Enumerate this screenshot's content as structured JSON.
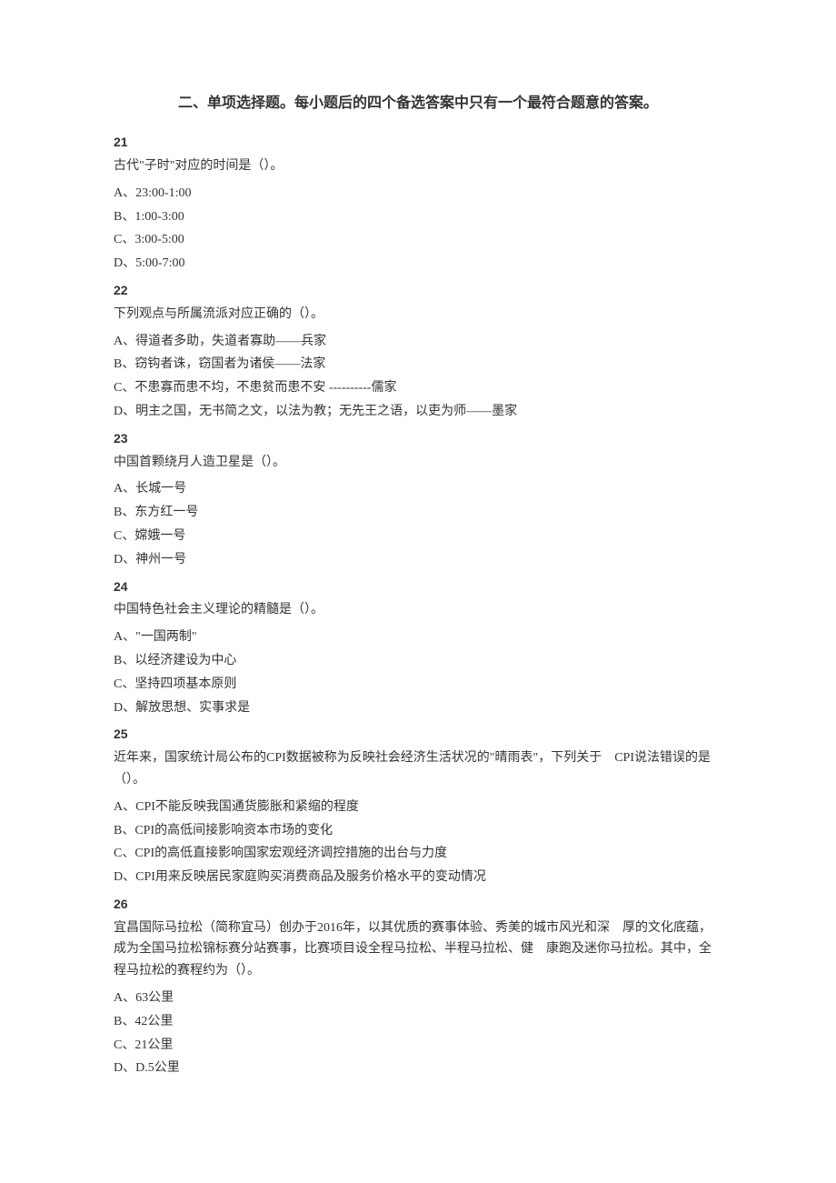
{
  "section_title": "二、单项选择题。每小题后的四个备选答案中只有一个最符合题意的答案。",
  "questions": [
    {
      "num": "21",
      "stem": "古代\"子时\"对应的时间是（）。",
      "opts": [
        "A、23:00-1:00",
        "B、1:00-3:00",
        "C、3:00-5:00",
        "D、5:00-7:00"
      ]
    },
    {
      "num": "22",
      "stem": "下列观点与所属流派对应正确的（）。",
      "opts": [
        "A、得道者多助，失道者寡助——兵家",
        "B、窃钩者诛，窃国者为诸侯——法家",
        "C、不患寡而患不均，不患贫而患不安 ----------儒家",
        "D、明主之国，无书简之文，以法为教；无先王之语，以吏为师——墨家"
      ]
    },
    {
      "num": "23",
      "stem": "中国首颗绕月人造卫星是（）。",
      "opts": [
        "A、长城一号",
        "B、东方红一号",
        "C、嫦娥一号",
        "D、神州一号"
      ]
    },
    {
      "num": "24",
      "stem": "中国特色社会主义理论的精髓是（）。",
      "opts": [
        "A、\"一国两制\"",
        "B、以经济建设为中心",
        "C、坚持四项基本原则",
        "D、解放思想、实事求是"
      ]
    },
    {
      "num": "25",
      "stem": "近年来，国家统计局公布的CPI数据被称为反映社会经济生活状况的\"晴雨表\"，下列关于　CPI说法错误的是（）。",
      "opts": [
        "A、CPI不能反映我国通货膨胀和紧缩的程度",
        "B、CPI的高低间接影响资本市场的变化",
        "C、CPI的高低直接影响国家宏观经济调控措施的出台与力度",
        "D、CPI用来反映居民家庭购买消费商品及服务价格水平的变动情况"
      ]
    },
    {
      "num": "26",
      "stem": "宜昌国际马拉松（简称宜马）创办于2016年，以其优质的赛事体验、秀美的城市风光和深　厚的文化底蕴，成为全国马拉松锦标赛分站赛事，比赛项目设全程马拉松、半程马拉松、健　康跑及迷你马拉松。其中，全程马拉松的赛程约为（）。",
      "opts": [
        "A、63公里",
        "B、42公里",
        "C、21公里",
        "D、D.5公里"
      ]
    }
  ]
}
